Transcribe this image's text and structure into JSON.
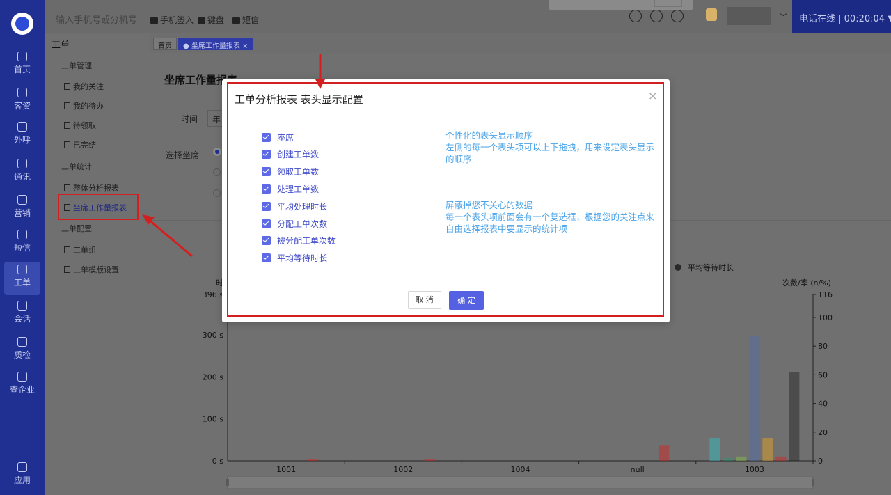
{
  "rail": {
    "items": [
      {
        "label": "首页",
        "icon": "home-icon"
      },
      {
        "label": "客资",
        "icon": "customer-icon"
      },
      {
        "label": "外呼",
        "icon": "outbound-call-icon"
      },
      {
        "label": "通讯",
        "icon": "contacts-icon"
      },
      {
        "label": "营销",
        "icon": "marketing-icon"
      },
      {
        "label": "短信",
        "icon": "sms-icon"
      },
      {
        "label": "工单",
        "icon": "work-order-icon"
      },
      {
        "label": "会话",
        "icon": "chat-icon"
      },
      {
        "label": "质检",
        "icon": "quality-icon"
      },
      {
        "label": "查企业",
        "icon": "company-icon"
      },
      {
        "label": "应用",
        "icon": "apps-icon"
      }
    ]
  },
  "topbar": {
    "search_placeholder": "输入手机号或分机号",
    "sign_in": "手机签入",
    "keyboard": "键盘",
    "sms": "短信",
    "status": "电话在线 |",
    "timer": "00:20:04"
  },
  "menu": {
    "title": "工单",
    "group_manage": "工单管理",
    "my_focus": "我的关注",
    "my_todo": "我的待办",
    "to_claim": "待领取",
    "done": "已完结",
    "group_stats": "工单统计",
    "overall_report": "整体分析报表",
    "agent_report": "坐席工作量报表",
    "group_config": "工单配置",
    "order_group": "工单组",
    "template_settings": "工单模版设置"
  },
  "tabs": {
    "home": "首页",
    "agent_report": "坐席工作量报表"
  },
  "page": {
    "title": "坐席工作量报表",
    "time_label": "时间",
    "time_value_partial": "年",
    "select_agent_label": "选择坐席"
  },
  "chart_data": {
    "type": "bar",
    "categories": [
      "1001",
      "1002",
      "1004",
      "null",
      "1003"
    ],
    "left_axis": {
      "label": "时",
      "ticks": [
        "396 s",
        "300 s",
        "200 s",
        "100 s",
        "0 s"
      ],
      "ylim": [
        0,
        396
      ]
    },
    "right_axis": {
      "label": "次数/率 (n/%)",
      "ticks": [
        "116",
        "100",
        "80",
        "60",
        "40",
        "20",
        "0"
      ],
      "ylim": [
        0,
        116
      ]
    },
    "legend_visible": [
      "平均等待时长"
    ],
    "series_right": [
      {
        "color": "#2fc6c8",
        "values": [
          0,
          0,
          0,
          0,
          16
        ]
      },
      {
        "color": "#2a9a7a",
        "values": [
          0,
          0,
          0,
          0,
          2
        ]
      },
      {
        "color": "#8bc34a",
        "values": [
          0,
          0,
          0,
          0,
          3
        ]
      },
      {
        "color": "#4f6fb0",
        "values": [
          0,
          0,
          0,
          0,
          87
        ]
      },
      {
        "color": "#f0a820",
        "values": [
          0,
          0,
          0,
          0,
          16
        ]
      },
      {
        "color": "#e02020",
        "values": [
          1,
          1,
          0,
          11,
          3
        ]
      },
      {
        "color": "#222222",
        "values": [
          0,
          0,
          0,
          0,
          62
        ]
      }
    ]
  },
  "modal": {
    "title": "工单分析报表 表头显示配置",
    "close": "×",
    "fields": [
      "座席",
      "创建工单数",
      "领取工单数",
      "处理工单数",
      "平均处理时长",
      "分配工单次数",
      "被分配工单次数",
      "平均等待时长"
    ],
    "hint1_title": "个性化的表头显示顺序",
    "hint1_body": "左侧的每一个表头项可以上下拖拽，用来设定表头显示的顺序",
    "hint2_title": "屏蔽掉您不关心的数据",
    "hint2_body": "每一个表头项前面会有一个复选框，根据您的关注点来自由选择报表中要显示的统计项",
    "cancel": "取 消",
    "ok": "确 定"
  }
}
